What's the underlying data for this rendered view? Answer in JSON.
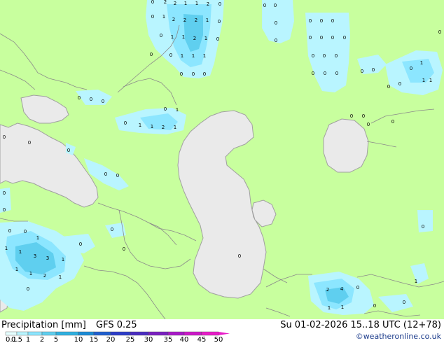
{
  "title": {
    "label": "Precipitation [mm]",
    "model": "GFS 0.25"
  },
  "valid": "Su 01-02-2026 15..18 UTC (12+78)",
  "credit": "©weatheronline.co.uk",
  "colors": {
    "land": "#c8ff9e",
    "water": "#eaeaea",
    "border": "#8a8a8a",
    "coast": "#a0a0a0"
  },
  "legend": {
    "labels": [
      "0.1",
      "0.5",
      "1",
      "2",
      "5",
      "10",
      "15",
      "20",
      "25",
      "30",
      "35",
      "40",
      "45",
      "50"
    ],
    "colors": [
      "#e6ffff",
      "#b9f5ff",
      "#8ce6ff",
      "#5fcfef",
      "#2eb0e0",
      "#1a8bd6",
      "#1f5fcf",
      "#2c3cc8",
      "#4a2cc0",
      "#7a1fc0",
      "#a818c8",
      "#cc18c8",
      "#e81cc8"
    ]
  },
  "map_numbers": [
    "0",
    "1",
    "2",
    "3",
    "4",
    "6"
  ]
}
